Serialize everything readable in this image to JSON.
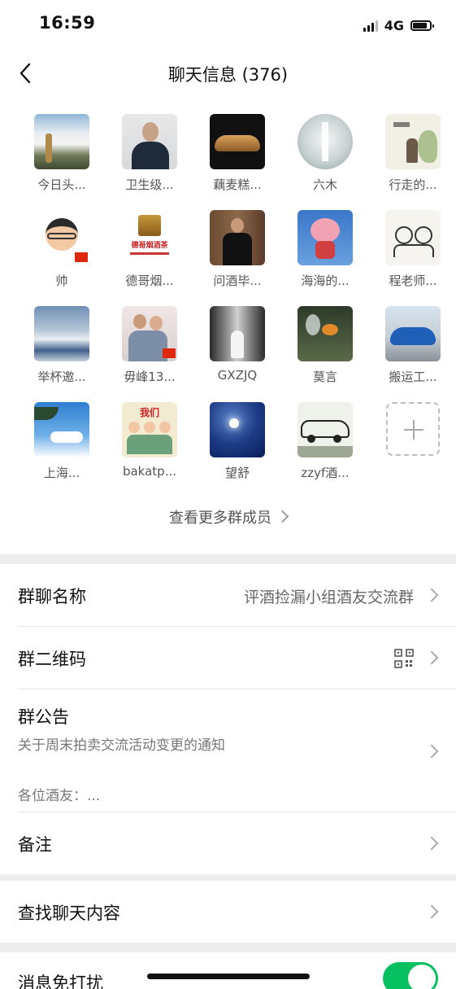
{
  "status": {
    "time": "16:59",
    "network": "4G"
  },
  "nav": {
    "title": "聊天信息 (376)"
  },
  "members": [
    {
      "name": "今日头...",
      "avatar": "mountain-clouds"
    },
    {
      "name": "卫生级...",
      "avatar": "man-in-suit"
    },
    {
      "name": "藕麦糕...",
      "avatar": "silver-car"
    },
    {
      "name": "六木",
      "avatar": "waterfall"
    },
    {
      "name": "行走的...",
      "avatar": "ink-painting"
    },
    {
      "name": "帅",
      "avatar": "cartoon-boy"
    },
    {
      "name": "德哥烟...",
      "avatar": "liquor-box",
      "overlay_text": "德哥烟酒茶"
    },
    {
      "name": "问酒毕...",
      "avatar": "man-bookshelf"
    },
    {
      "name": "海海的...",
      "avatar": "pig-toy"
    },
    {
      "name": "程老师...",
      "avatar": "sketch-couple"
    },
    {
      "name": "举杯邀...",
      "avatar": "seaside-sky"
    },
    {
      "name": "毋峰13...",
      "avatar": "couple-photo"
    },
    {
      "name": "GXZJQ",
      "avatar": "wedding-bw"
    },
    {
      "name": "莫言",
      "avatar": "goldfish"
    },
    {
      "name": "搬运工...",
      "avatar": "blue-car"
    },
    {
      "name": "上海...",
      "avatar": "blue-sky-roof"
    },
    {
      "name": "bakatp...",
      "avatar": "family-cartoon",
      "overlay_text": "我们"
    },
    {
      "name": "望舒",
      "avatar": "moon-night"
    },
    {
      "name": "zzyf酒...",
      "avatar": "manga-car"
    }
  ],
  "more_members": "查看更多群成员",
  "settings": {
    "group_name_label": "群聊名称",
    "group_name_value": "评酒捡漏小组酒友交流群",
    "qr_label": "群二维码",
    "notice_label": "群公告",
    "notice_title": "关于周末拍卖交流活动变更的通知",
    "notice_body": "各位酒友：...",
    "remark_label": "备注",
    "search_label": "查找聊天内容",
    "mute_label": "消息免打扰",
    "mute_on": true
  },
  "colors": {
    "accent": "#07c160",
    "background": "#ededed"
  }
}
